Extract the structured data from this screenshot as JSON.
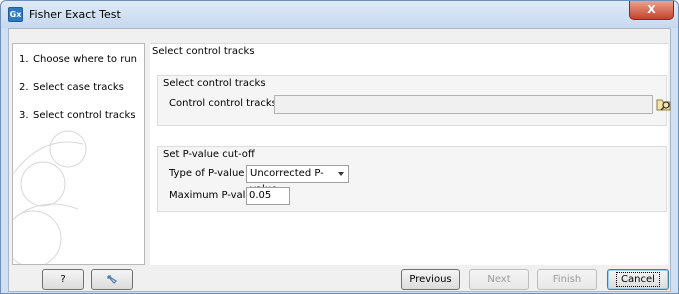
{
  "window": {
    "title": "Fisher Exact Test",
    "app_icon": "Gx",
    "close_glyph": "X"
  },
  "steps": [
    {
      "num": "1.",
      "label": "Choose where to run"
    },
    {
      "num": "2.",
      "label": "Select case tracks"
    },
    {
      "num": "3.",
      "label": "Select control tracks"
    }
  ],
  "main": {
    "heading": "Select control tracks",
    "control_group": {
      "title": "Select control tracks",
      "field_label": "Control control tracks",
      "field_value": ""
    },
    "pvalue_group": {
      "title": "Set P-value cut-off",
      "type_label": "Type of P-value",
      "type_value": "Uncorrected P-value",
      "max_label": "Maximum P-value",
      "max_value": "0.05"
    }
  },
  "buttons": {
    "help": "?",
    "previous": "Previous",
    "next": "Next",
    "finish": "Finish",
    "cancel": "Cancel"
  },
  "icons": [
    "app-icon",
    "close-icon",
    "browse-folder-icon",
    "dropdown-arrow-icon",
    "reset-icon",
    "watermark-logo"
  ],
  "colors": {
    "titlebar": "#c6d9ef",
    "close": "#c7412a",
    "panel_bg": "#f0f0f0"
  }
}
